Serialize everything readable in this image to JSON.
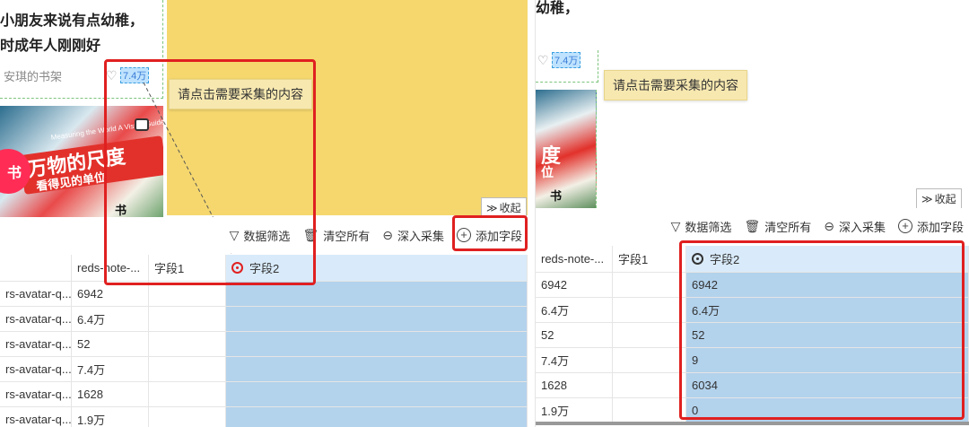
{
  "left": {
    "feed": {
      "title_line1": "小朋友来说有点幼稚，",
      "title_line2": "时成年人刚刚好",
      "author": "安琪的书架",
      "like_count": "7.4万",
      "cover_main": "万物的尺度",
      "cover_sub": "看得见的单位",
      "cover_eng": "Measuring the World A Visual Guide to Units",
      "cover_tiny": "书",
      "badge": "书"
    },
    "tooltip": "请点击需要采集的内容",
    "collapse_label": "收起",
    "toolbar": {
      "filter": "数据筛选",
      "clear": "清空所有",
      "deep": "深入采集",
      "add": "添加字段"
    },
    "table": {
      "headers": [
        "",
        "reds-note-...",
        "字段1",
        "字段2"
      ],
      "rows": [
        [
          "rs-avatar-q...",
          "6942",
          "",
          ""
        ],
        [
          "rs-avatar-q...",
          "6.4万",
          "",
          ""
        ],
        [
          "rs-avatar-q...",
          "52",
          "",
          ""
        ],
        [
          "rs-avatar-q...",
          "7.4万",
          "",
          ""
        ],
        [
          "rs-avatar-q...",
          "1628",
          "",
          ""
        ],
        [
          "rs-avatar-q...",
          "1.9万",
          "",
          ""
        ]
      ]
    }
  },
  "right": {
    "feed": {
      "title_fragment": "幼稚，",
      "like_count": "7.4万",
      "cover_text": "度",
      "cover_text2": "位",
      "cover_tiny": "书"
    },
    "tooltip": "请点击需要采集的内容",
    "collapse_label": "收起",
    "toolbar": {
      "filter": "数据筛选",
      "clear": "清空所有",
      "deep": "深入采集",
      "add": "添加字段"
    },
    "table": {
      "headers": [
        "reds-note-...",
        "字段1",
        "字段2"
      ],
      "rows": [
        [
          "6942",
          "",
          "6942"
        ],
        [
          "6.4万",
          "",
          "6.4万"
        ],
        [
          "52",
          "",
          "52"
        ],
        [
          "7.4万",
          "",
          "9"
        ],
        [
          "1628",
          "",
          "6034"
        ],
        [
          "1.9万",
          "",
          "0"
        ]
      ]
    }
  },
  "colors": {
    "highlight_red": "#e02020",
    "selection_blue": "#b3d2ec",
    "tooltip_bg": "#f7e8b0",
    "yellow_area": "#f5d76e",
    "badge_pink": "#ff2d55"
  }
}
